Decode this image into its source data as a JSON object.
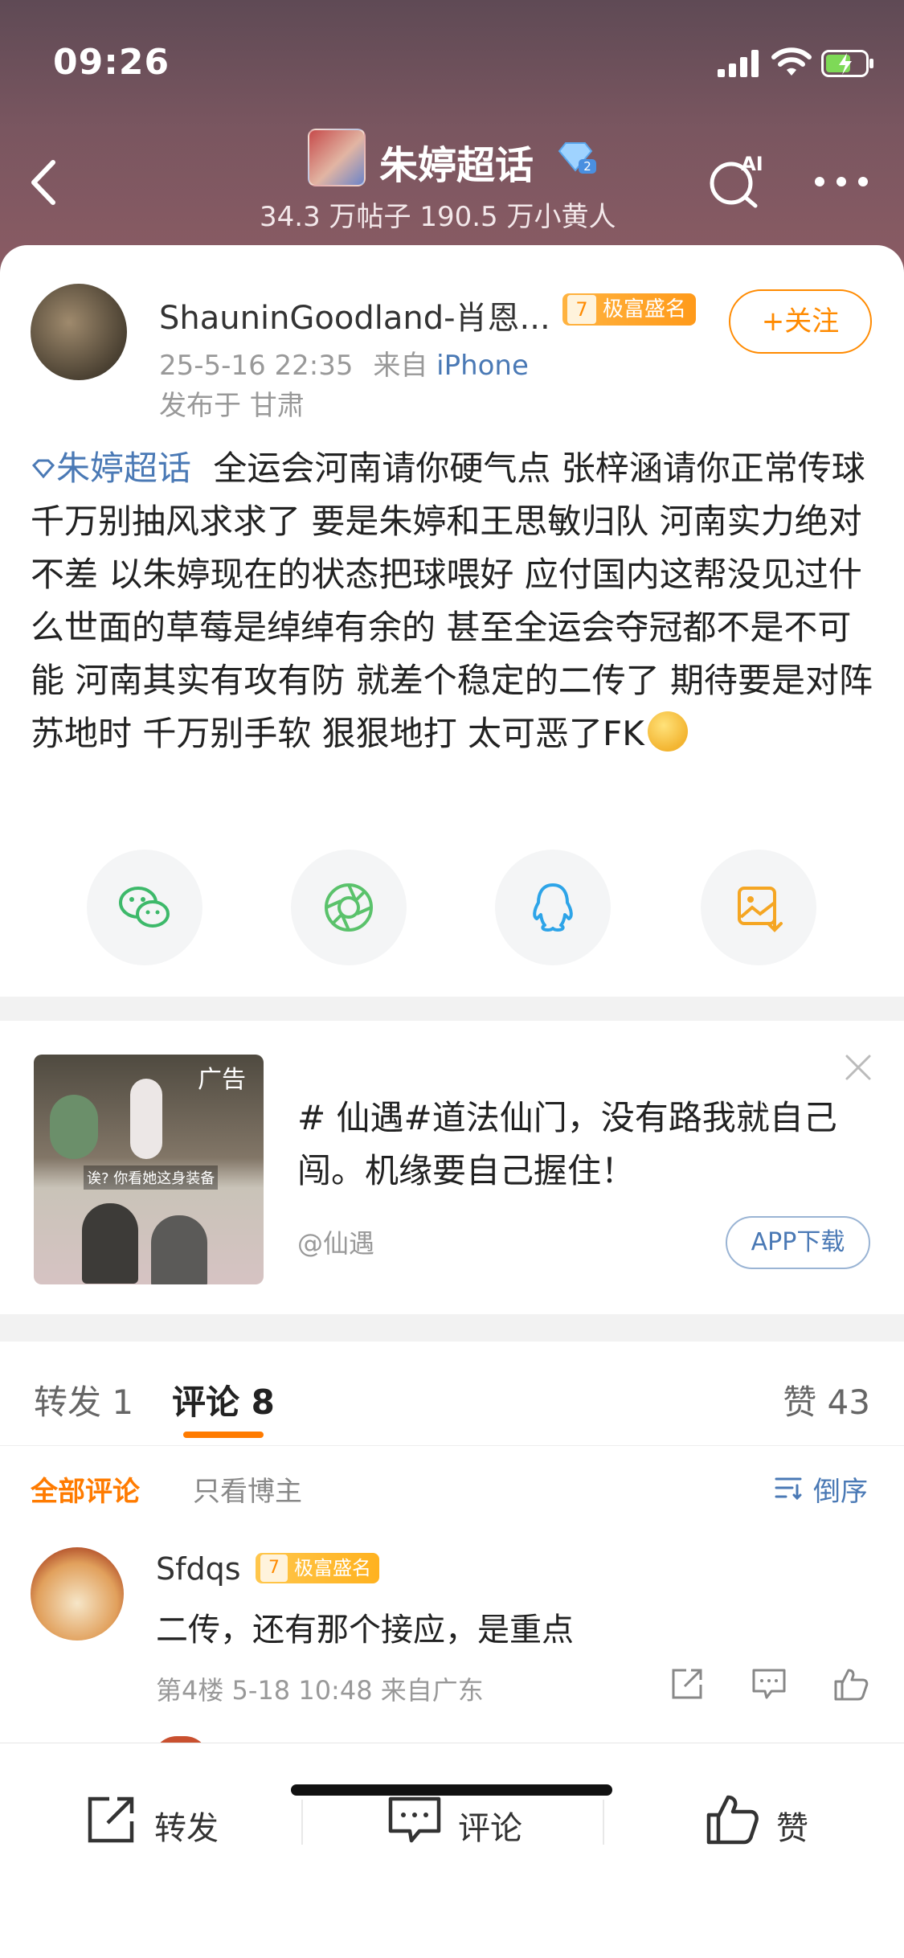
{
  "status_bar": {
    "time": "09:26"
  },
  "header": {
    "topic_name": "朱婷超话",
    "stats": "34.3 万帖子 190.5 万小黄人",
    "ai_label": "AI"
  },
  "post": {
    "username": "ShauninGoodland-肖恩...",
    "badge_level": "7",
    "badge_text": "极富盛名",
    "follow_label": "+关注",
    "date": "25-5-16 22:35",
    "source_prefix": "来自",
    "source": "iPhone",
    "location": "发布于 甘肃",
    "topic_tag": "朱婷超话",
    "content": "全运会河南请你硬气点 张梓涵请你正常传球千万别抽风求求了 要是朱婷和王思敏归队 河南实力绝对不差 以朱婷现在的状态把球喂好 应付国内这帮没见过什么世面的草莓是绰绰有余的 甚至全运会夺冠都不是不可能 河南其实有攻有防 就差个稳定的二传了 期待要是对阵苏地时 千万别手软 狠狠地打 太可恶了FK"
  },
  "share_icons": [
    "wechat-icon",
    "moments-icon",
    "qq-icon",
    "save-image-icon"
  ],
  "ad": {
    "tag": "广告",
    "caption": "诶? 你看她这身装备",
    "text": "# 仙遇#道法仙门，没有路我就自己闯。机缘要自己握住！",
    "source": "@仙遇",
    "button": "APP下载"
  },
  "tabs": {
    "repost": "转发 1",
    "comment": "评论 8",
    "likes": "赞 43"
  },
  "filters": {
    "all": "全部评论",
    "op_only": "只看博主",
    "sort": "倒序"
  },
  "comments": [
    {
      "name": "Sfdqs",
      "badge_level": "7",
      "badge_text": "极富盛名",
      "text": "二传，还有那个接应，是重点",
      "meta": "第4楼 5-18 10:48 来自广东"
    }
  ],
  "bottom_bar": {
    "repost": "转发",
    "comment": "评论",
    "like": "赞"
  },
  "colors": {
    "accent": "#ff7b00",
    "link": "#4a79b5"
  }
}
